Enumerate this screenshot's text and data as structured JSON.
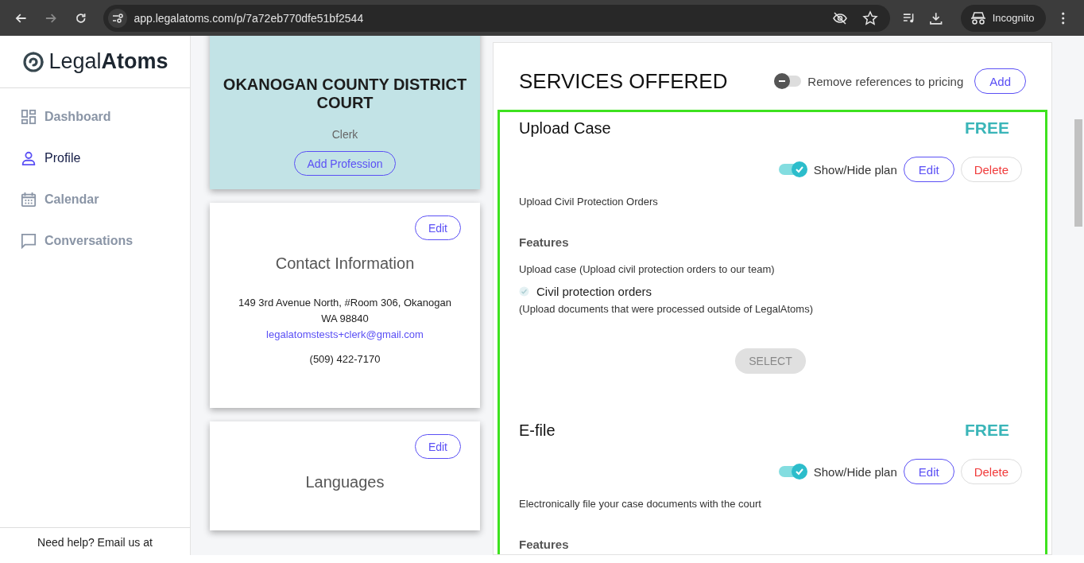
{
  "browser": {
    "url": "app.legalatoms.com/p/7a72eb770dfe51bf2544",
    "incognito_label": "Incognito"
  },
  "sidebar": {
    "logo": "Legal**Atoms**",
    "items": [
      {
        "label": "Dashboard",
        "kind": "dashboard",
        "selected": false
      },
      {
        "label": "Profile",
        "kind": "person",
        "selected": true
      },
      {
        "label": "Calendar",
        "kind": "calendar",
        "selected": false
      },
      {
        "label": "Conversations",
        "kind": "chat",
        "selected": false
      }
    ],
    "help_text": "Need help? Email us at"
  },
  "org_card": {
    "name": "OKANOGAN COUNTY DISTRICT COURT",
    "role": "Clerk",
    "button": "Add Profession"
  },
  "contact_card": {
    "edit": "Edit",
    "title": "Contact Information",
    "address": [
      "149 3rd Avenue North, #Room 306, Okanogan",
      "WA 98840"
    ],
    "email": "legalatomstests+clerk@gmail.com",
    "phone": "(509) 422-7170"
  },
  "languages_card": {
    "edit": "Edit",
    "title": "Languages"
  },
  "services": {
    "title": "SERVICES OFFERED",
    "pricing_toggle": {
      "label": "Remove references to pricing",
      "on": false
    },
    "add": "Add",
    "highlighted": true,
    "plans": [
      {
        "name": "Upload Case",
        "price": "FREE",
        "visible": true,
        "toggle_label": "Show/Hide plan",
        "edit": "Edit",
        "delete": "Delete",
        "description": "Upload Civil Protection Orders",
        "features_heading": "Features",
        "feature_intro": "Upload case (Upload civil protection orders to our team)",
        "features": [
          {
            "label": "Civil protection orders",
            "note": "(Upload documents that were processed outside of LegalAtoms)"
          }
        ],
        "select": "SELECT"
      },
      {
        "name": "E-file",
        "price": "FREE",
        "visible": true,
        "toggle_label": "Show/Hide plan",
        "edit": "Edit",
        "delete": "Delete",
        "description": "Electronically file your case documents with the court",
        "features_heading": "Features"
      }
    ]
  }
}
